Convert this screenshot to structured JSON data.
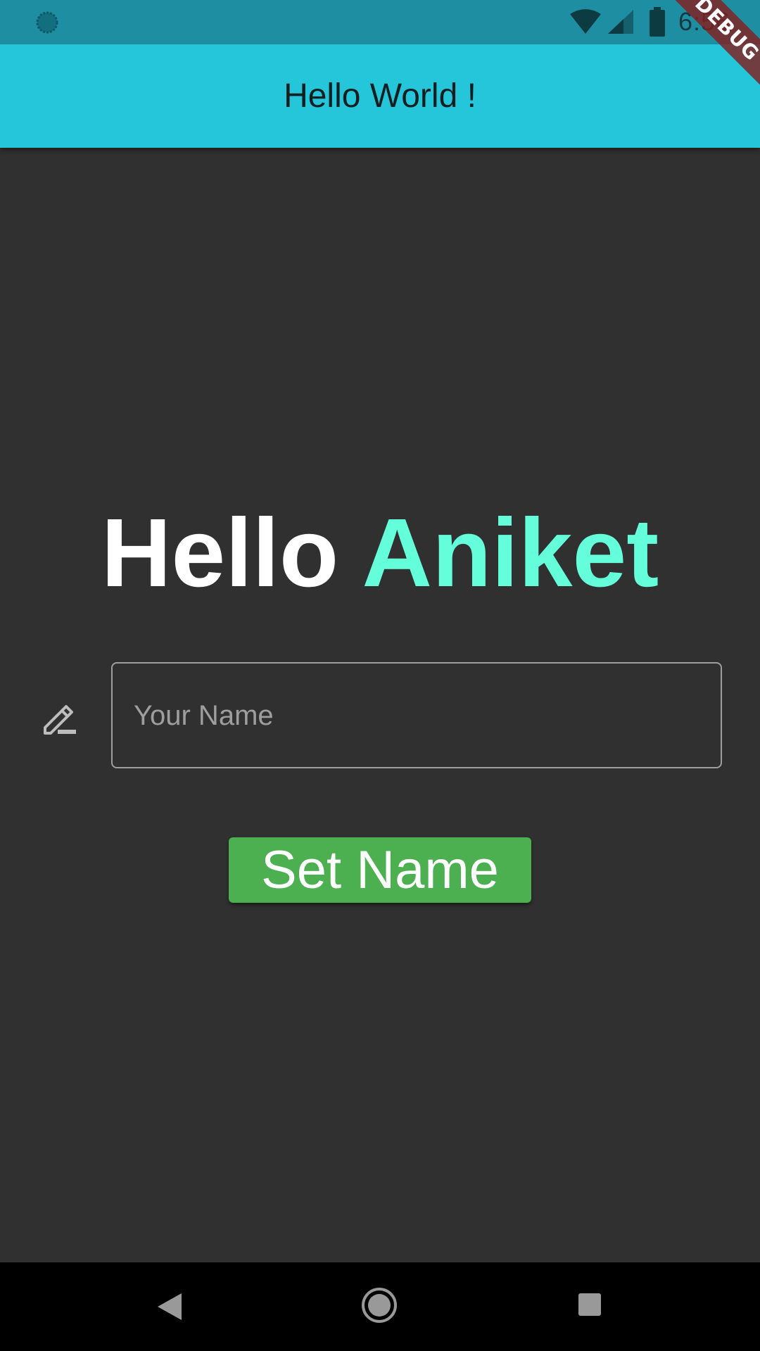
{
  "status_bar": {
    "time": "6:56",
    "icons": [
      "sync-icon",
      "wifi-icon",
      "signal-icon",
      "battery-icon"
    ],
    "background": "#1e8fa3"
  },
  "app_bar": {
    "title": "Hello World !",
    "background": "#26c6da"
  },
  "debug_banner": {
    "label": "DEBUG"
  },
  "greeting": {
    "hello": "Hello",
    "name": "Aniket",
    "name_color": "#64ffda"
  },
  "name_field": {
    "icon": "edit-icon",
    "value": "",
    "placeholder": "Your Name"
  },
  "set_name_button": {
    "label": "Set Name",
    "color": "#4caf50"
  },
  "nav_bar": {
    "items": [
      "back-icon",
      "home-icon",
      "recents-icon"
    ]
  }
}
